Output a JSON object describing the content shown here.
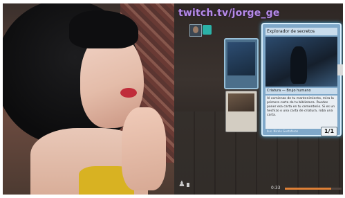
{
  "overlay": {
    "twitch_url": "twitch.tv/jorge_ge"
  },
  "card": {
    "name": "Explorador de secretos",
    "type_line": "Criatura — Brujo humano",
    "rules_text": "Al comienzo de tu mantenimiento, mira la primera carta de tu biblioteca. Puedes poner esa carta en tu cementerio. Si es un hechizo o una carta de criatura, roba una carta.",
    "artist": "Ilus. Nicole Gustafsson",
    "power_toughness": "1/1"
  },
  "player": {
    "timer": "0:33",
    "progress": 0.82
  },
  "icons": {
    "player_portrait": "portrait-icon",
    "mana": "teal-gem-icon",
    "bottom": "player-icon",
    "expand": "chevron-right-icon"
  },
  "colors": {
    "twitch": "#b58ae8",
    "progress": "#e08036",
    "card_border": "#d7eefc"
  }
}
